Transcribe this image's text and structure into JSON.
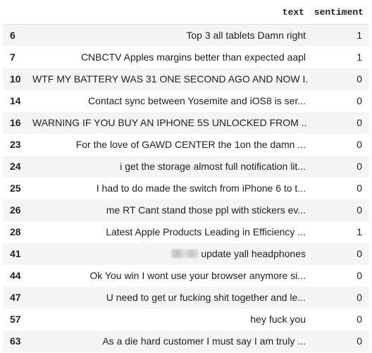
{
  "header": {
    "index_label": "",
    "text_label": "text",
    "sentiment_label": "sentiment"
  },
  "rows": [
    {
      "index": "6",
      "text": "Top 3 all tablets Damn right",
      "sentiment": "1"
    },
    {
      "index": "7",
      "text": "CNBCTV Apples margins better than expected aapl",
      "sentiment": "1"
    },
    {
      "index": "10",
      "text": "WTF MY BATTERY WAS 31 ONE SECOND AGO AND NOW I...",
      "sentiment": "0"
    },
    {
      "index": "14",
      "text": "Contact sync between Yosemite and iOS8 is ser...",
      "sentiment": "0"
    },
    {
      "index": "16",
      "text": "WARNING IF YOU BUY AN IPHONE 5S UNLOCKED FROM ...",
      "sentiment": "0"
    },
    {
      "index": "23",
      "text": "For the love of GAWD CENTER the 1on the damn ...",
      "sentiment": "0"
    },
    {
      "index": "24",
      "text": "i get the storage almost full notification lit...",
      "sentiment": "0"
    },
    {
      "index": "25",
      "text": "I had to do made the switch from iPhone 6 to t...",
      "sentiment": "0"
    },
    {
      "index": "26",
      "text": "me RT Cant stand those ppl with stickers ev...",
      "sentiment": "0"
    },
    {
      "index": "28",
      "text": "Latest Apple Products Leading in Efficiency ...",
      "sentiment": "1"
    },
    {
      "index": "41",
      "text": "update yall headphones",
      "sentiment": "0",
      "redacted_prefix": true
    },
    {
      "index": "44",
      "text": "Ok You win I wont use your browser anymore si...",
      "sentiment": "0"
    },
    {
      "index": "47",
      "text": "U need to get ur fucking shit together and le...",
      "sentiment": "0"
    },
    {
      "index": "57",
      "text": "hey fuck you",
      "sentiment": "0"
    },
    {
      "index": "63",
      "text": "As a die hard customer I must say I am truly ...",
      "sentiment": "0"
    }
  ],
  "colors": {
    "row_stripe": "#f5f5f5",
    "text": "#212121",
    "border": "#e0e0e0"
  }
}
